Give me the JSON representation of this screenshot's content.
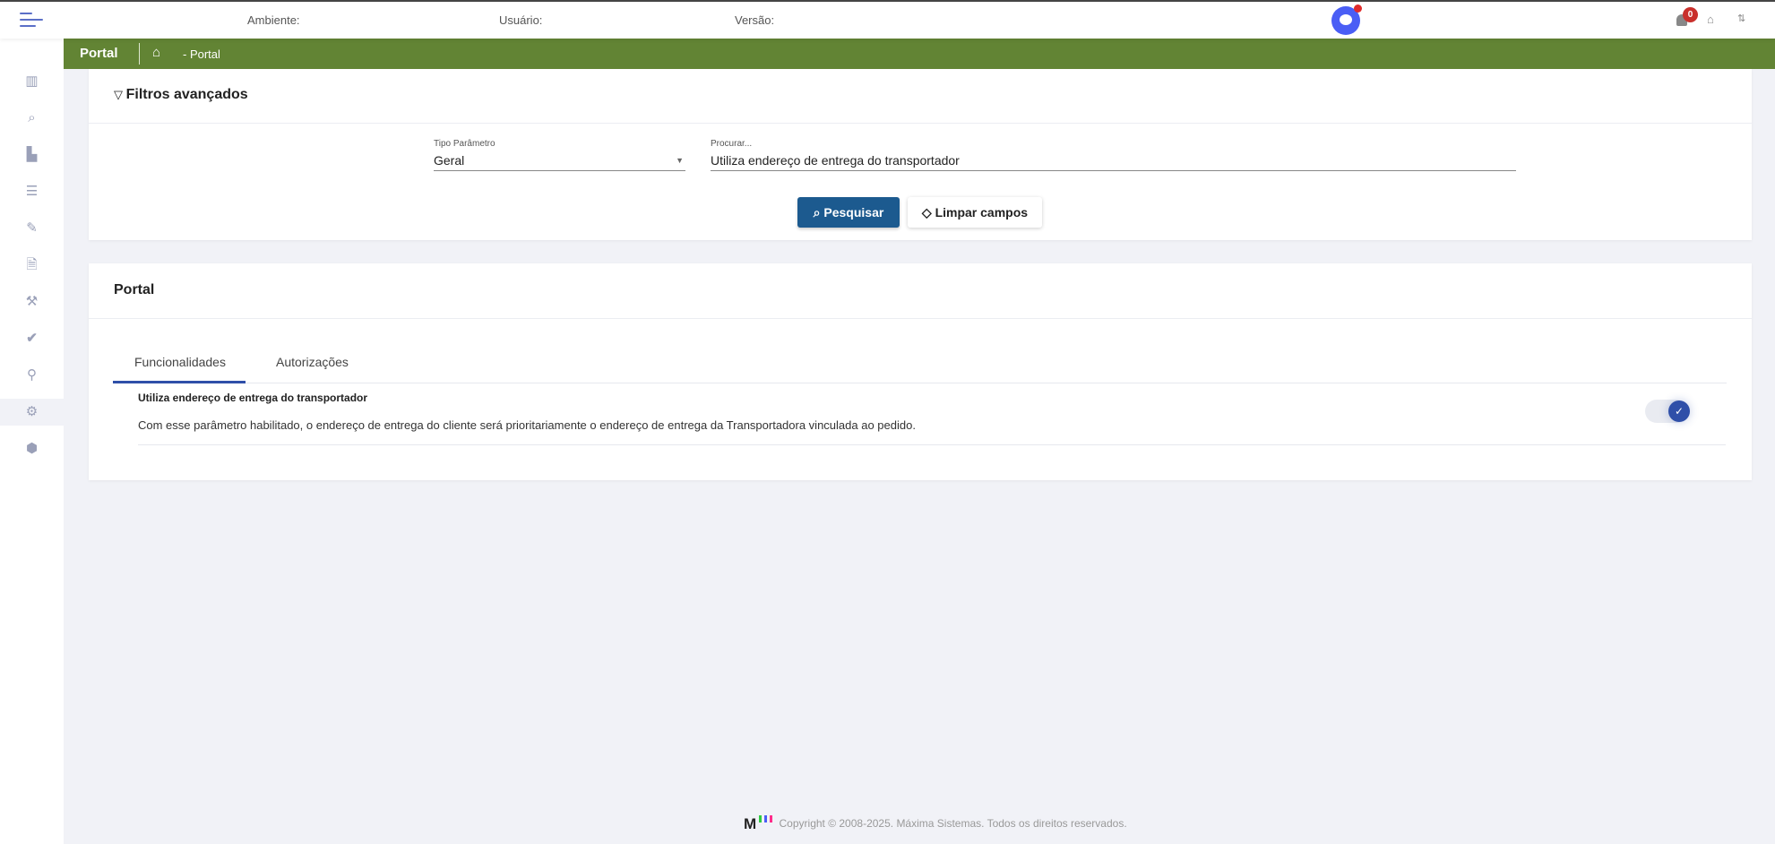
{
  "topbar": {
    "ambiente_label": "Ambiente:",
    "usuario_label": "Usuário:",
    "versao_label": "Versão:",
    "notification_count": "0"
  },
  "breadcrumb": {
    "title": "Portal",
    "path": "- Portal"
  },
  "sidebar": {
    "items": [
      {
        "icon": "map-icon"
      },
      {
        "icon": "search-icon"
      },
      {
        "icon": "chart-icon"
      },
      {
        "icon": "list-icon"
      },
      {
        "icon": "edit-icon"
      },
      {
        "icon": "code-file-icon"
      },
      {
        "icon": "tools-icon"
      },
      {
        "icon": "double-check-icon"
      },
      {
        "icon": "pin-icon"
      },
      {
        "icon": "gear-icon",
        "active": true
      },
      {
        "icon": "box-icon"
      }
    ]
  },
  "filters": {
    "title": "Filtros avançados",
    "tipo_label": "Tipo Parâmetro",
    "tipo_value": "Geral",
    "search_label": "Procurar...",
    "search_value": "Utiliza endereço de entrega do transportador",
    "search_button": "Pesquisar",
    "clear_button": "Limpar campos"
  },
  "portal": {
    "title": "Portal",
    "tabs": [
      {
        "label": "Funcionalidades",
        "active": true
      },
      {
        "label": "Autorizações"
      }
    ],
    "items": [
      {
        "title": "Utiliza endereço de entrega do transportador",
        "description": "Com esse parâmetro habilitado, o endereço de entrega do cliente será prioritariamente o endereço de entrega da Transportadora vinculada ao pedido.",
        "enabled": true
      }
    ]
  },
  "footer": {
    "logo": "M",
    "copyright": "Copyright © 2008-2025. Máxima Sistemas. Todos os direitos reservados."
  },
  "colors": {
    "green": "#628434",
    "primary": "#1c5a8f",
    "toggle": "#2f4fa8"
  }
}
